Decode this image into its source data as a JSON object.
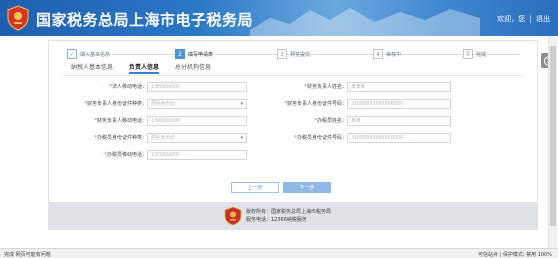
{
  "header": {
    "title": "国家税务总局上海市电子税务局",
    "welcome": "欢迎，您",
    "separator": "|",
    "logout": "退出"
  },
  "steps": [
    {
      "num": "✓",
      "label": "填入基本信息",
      "state": "done"
    },
    {
      "num": "2",
      "label": "填写申请表",
      "state": "active"
    },
    {
      "num": "3",
      "label": "预览提交",
      "state": "todo"
    },
    {
      "num": "4",
      "label": "审核中",
      "state": "todo"
    },
    {
      "num": "5",
      "label": "完成",
      "state": "todo"
    }
  ],
  "tabs": [
    {
      "label": "纳税人基本信息",
      "active": false
    },
    {
      "label": "负责人信息",
      "active": true
    },
    {
      "label": "总分机构信息",
      "active": false
    }
  ],
  "form": {
    "left": [
      {
        "label": "法人移动电话：",
        "required": true,
        "value": "1380000000",
        "type": "text"
      },
      {
        "label": "财务负责人身份证件种类：",
        "required": true,
        "value": "居民身份证",
        "type": "select"
      },
      {
        "label": "财务负责人移动电话：",
        "required": true,
        "value": "1390000000",
        "type": "text"
      },
      {
        "label": "办税员身份证件种类：",
        "required": true,
        "value": "居民身份证",
        "type": "select"
      },
      {
        "label": "办税员移动电话：",
        "required": true,
        "value": "1370000000",
        "type": "text"
      }
    ],
    "right": [
      {
        "label": "财务负责人姓名：",
        "required": true,
        "value": "某某某"
      },
      {
        "label": "财务负责人身份证件号码：",
        "required": true,
        "value": "310000000000000000"
      },
      {
        "label": "办税员姓名：",
        "required": true,
        "value": "某某"
      },
      {
        "label": "办税员身份证件号码：",
        "required": true,
        "value": "310000000000000000"
      }
    ]
  },
  "buttons": {
    "prev": "上一步",
    "next": "下一步"
  },
  "footer": {
    "line1": "版权所有：国家税务总局上海市税务局",
    "line2": "服务电话：12366纳税服务"
  },
  "statusbar": {
    "left": "完成   网页可能有问题",
    "right": "可信站点 | 保护模式: 禁用    100%"
  },
  "colors": {
    "header_blue": "#2a78c6",
    "accent": "#4d93d8",
    "required": "#e03b3b",
    "footer_bg": "#dfe2e7"
  }
}
